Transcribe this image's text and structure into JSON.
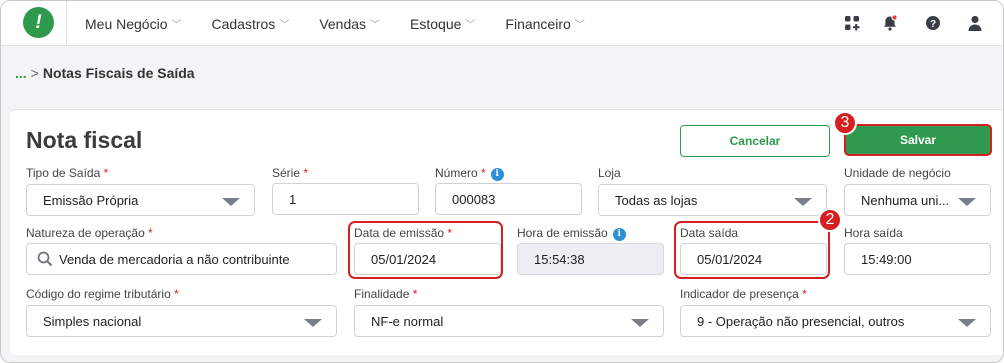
{
  "nav": {
    "logo_text": "!",
    "menu": [
      {
        "label": "Meu Negócio"
      },
      {
        "label": "Cadastros"
      },
      {
        "label": "Vendas"
      },
      {
        "label": "Estoque"
      },
      {
        "label": "Financeiro"
      }
    ],
    "icons": [
      "apps-icon",
      "notification-bell-icon",
      "help-icon",
      "user-avatar-icon"
    ],
    "accent": "#2f9a4e"
  },
  "breadcrumb": {
    "ellipsis": "...",
    "separator": ">",
    "current": "Notas Fiscais de Saída"
  },
  "page": {
    "title": "Nota fiscal",
    "cancel_label": "Cancelar",
    "save_label": "Salvar"
  },
  "form": {
    "tipo_saida": {
      "label": "Tipo de Saída",
      "value": "Emissão Própria"
    },
    "serie": {
      "label": "Série",
      "value": "1"
    },
    "numero": {
      "label": "Número",
      "value": "000083"
    },
    "loja": {
      "label": "Loja",
      "value": "Todas as lojas"
    },
    "unidade": {
      "label": "Unidade de negócio",
      "value": "Nenhuma uni..."
    },
    "natureza": {
      "label": "Natureza de operação",
      "value": "Venda de mercadoria a não contribuinte"
    },
    "data_emissao": {
      "label": "Data de emissão",
      "value": "05/01/2024"
    },
    "hora_emissao": {
      "label": "Hora de emissão",
      "value": "15:54:38"
    },
    "data_saida": {
      "label": "Data saída",
      "value": "05/01/2024"
    },
    "hora_saida": {
      "label": "Hora saída",
      "value": "15:49:00"
    },
    "regime": {
      "label": "Código do regime tributário",
      "value": "Simples nacional"
    },
    "finalidade": {
      "label": "Finalidade",
      "value": "NF-e normal"
    },
    "presenca": {
      "label": "Indicador de presença",
      "value": "9 - Operação não presencial, outros"
    },
    "required_mark": "*"
  },
  "annotations": {
    "step2": "2",
    "step3": "3",
    "color": "#d42020"
  }
}
